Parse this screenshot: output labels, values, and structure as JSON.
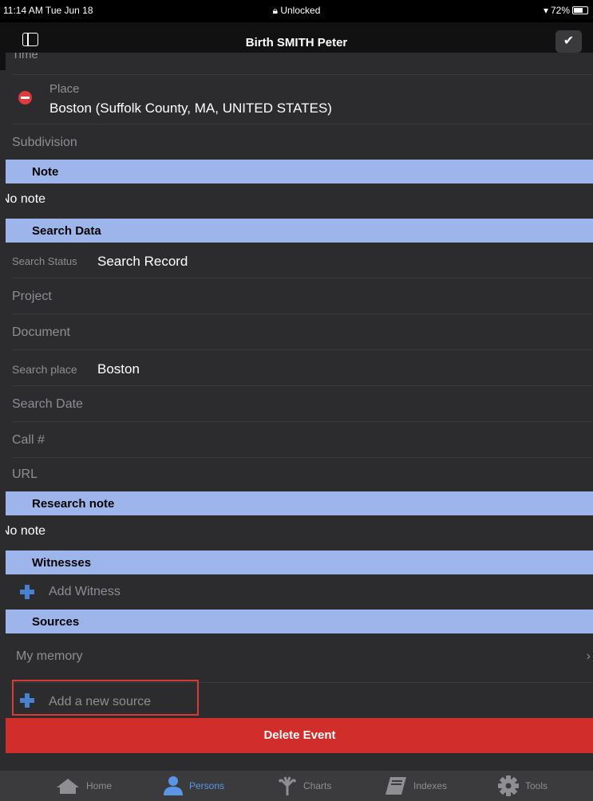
{
  "status": {
    "time": "11:14 AM  Tue Jun 18",
    "lock": "Unlocked",
    "battery": "72%"
  },
  "nav": {
    "title": "Birth SMITH Peter"
  },
  "rows": {
    "time_label": "Time",
    "place_label": "Place",
    "place_value": "Boston (Suffolk County, MA, UNITED STATES)",
    "subdivision_label": "Subdivision"
  },
  "note": {
    "header": "Note",
    "value": "No note"
  },
  "search": {
    "header": "Search Data",
    "status_label": "Search Status",
    "status_value": "Search Record",
    "project_label": "Project",
    "document_label": "Document",
    "place_label": "Search place",
    "place_value": "Boston",
    "date_label": "Search Date",
    "call_label": "Call #",
    "url_label": "URL"
  },
  "research": {
    "header": "Research note",
    "value": "No note"
  },
  "witnesses": {
    "header": "Witnesses",
    "add_label": "Add Witness"
  },
  "sources": {
    "header": "Sources",
    "item": "My memory",
    "add_label": "Add a new source"
  },
  "delete_label": "Delete Event",
  "tabs": [
    {
      "label": "Home",
      "icon": "home-icon"
    },
    {
      "label": "Persons",
      "icon": "person-icon"
    },
    {
      "label": "Charts",
      "icon": "tree-icon"
    },
    {
      "label": "Indexes",
      "icon": "book-icon"
    },
    {
      "label": "Tools",
      "icon": "gear-icon"
    }
  ],
  "colors": {
    "section": "#9db5ea",
    "delete": "#d12d2b",
    "accent": "#5a96e6",
    "plus": "#4a80d0"
  }
}
